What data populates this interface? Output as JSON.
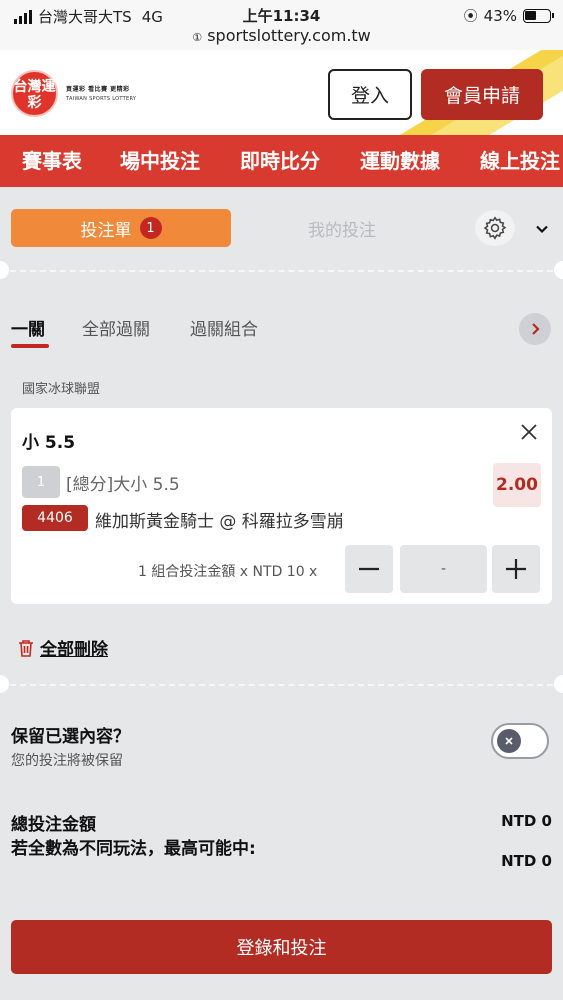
{
  "status_bar": {
    "carrier": "台灣大哥大TS",
    "network": "4G",
    "time": "上午11:34",
    "url": "sportslottery.com.tw",
    "battery": "43%"
  },
  "header": {
    "logo_mark": "台灣運彩",
    "logo_slogans": "買運彩 看比賽 更精彩",
    "logo_english": "TAIWAN SPORTS LOTTERY",
    "login_label": "登入",
    "register_label": "會員申請"
  },
  "nav": {
    "items": [
      "賽事表",
      "場中投注",
      "即時比分",
      "運動數據",
      "線上投注"
    ]
  },
  "betslip": {
    "tab_active_label": "投注單",
    "tab_active_count": "1",
    "tab_inactive_label": "我的投注",
    "subtabs": [
      "一關",
      "全部過關",
      "過關組合"
    ],
    "league": "國家冰球聯盟",
    "selection": {
      "title": "小 5.5",
      "number": "1",
      "market": "[總分]大小 5.5",
      "odds": "2.00",
      "code": "4406",
      "match": "維加斯黃金騎士 @ 科羅拉多雪崩",
      "stake_label": "1 組合投注金額 x NTD 10 x",
      "stake_value": "-"
    },
    "delete_all_label": "全部刪除",
    "keep_title": "保留已選內容？",
    "keep_sub": "您的投注將被保留",
    "total_label": "總投注金額",
    "total_value": "NTD 0",
    "max_win_label": "若全數為不同玩法，最高可能中:",
    "max_win_value": "NTD 0",
    "submit_label": "登錄和投注"
  },
  "colors": {
    "brand_red": "#d93a2f",
    "dark_red": "#b22c23",
    "orange": "#f0893a",
    "yellow": "#f6d44a"
  }
}
